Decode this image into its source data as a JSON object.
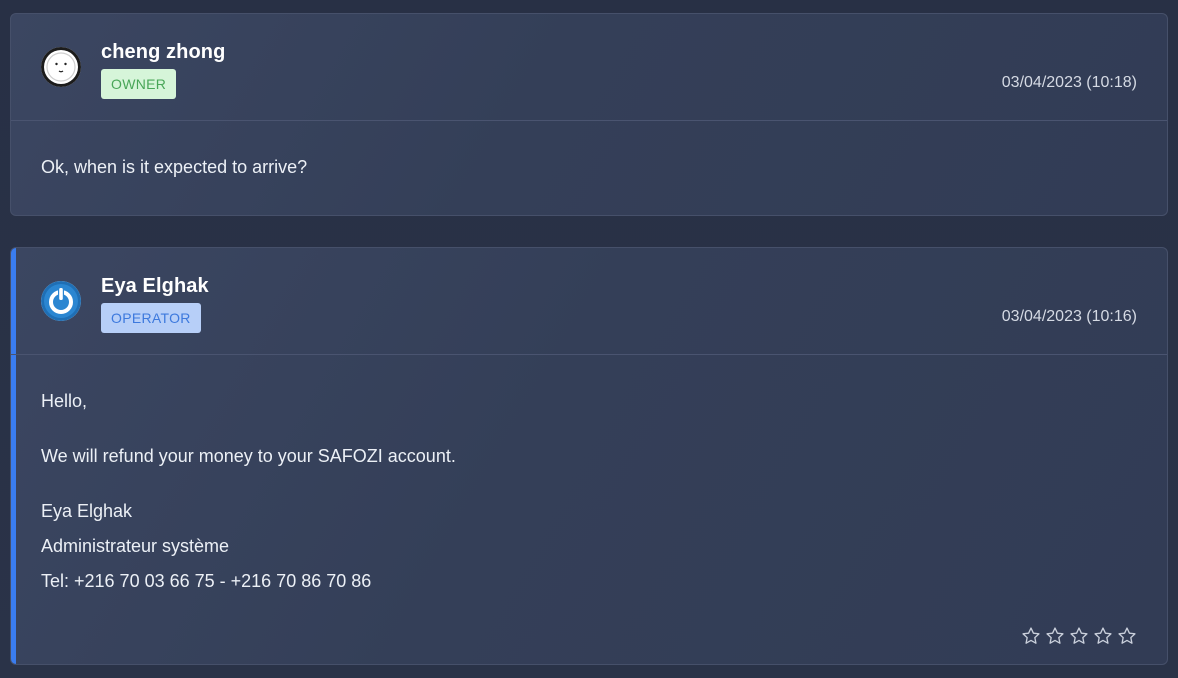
{
  "messages": [
    {
      "author": "cheng zhong",
      "role": "OWNER",
      "timestamp": "03/04/2023 (10:18)",
      "avatar_icon": "smiley-face-icon",
      "lines": [
        "Ok, when is it expected to arrive?"
      ]
    },
    {
      "author": "Eya Elghak",
      "role": "OPERATOR",
      "timestamp": "03/04/2023 (10:16)",
      "avatar_icon": "power-icon",
      "lines": [
        "Hello,",
        "We will refund your money to your SAFOZI account.",
        "Eya Elghak",
        "Administrateur système",
        "Tel: +216 70 03 66 75 - +216 70 86 70 86"
      ],
      "rating": {
        "value": 0,
        "max": 5
      }
    }
  ],
  "colors": {
    "owner_badge_bg": "#d6f5d9",
    "owner_badge_text": "#49a658",
    "operator_badge_bg": "#b7cff8",
    "operator_badge_text": "#3d79dd",
    "operator_accent": "#3a7df0"
  }
}
